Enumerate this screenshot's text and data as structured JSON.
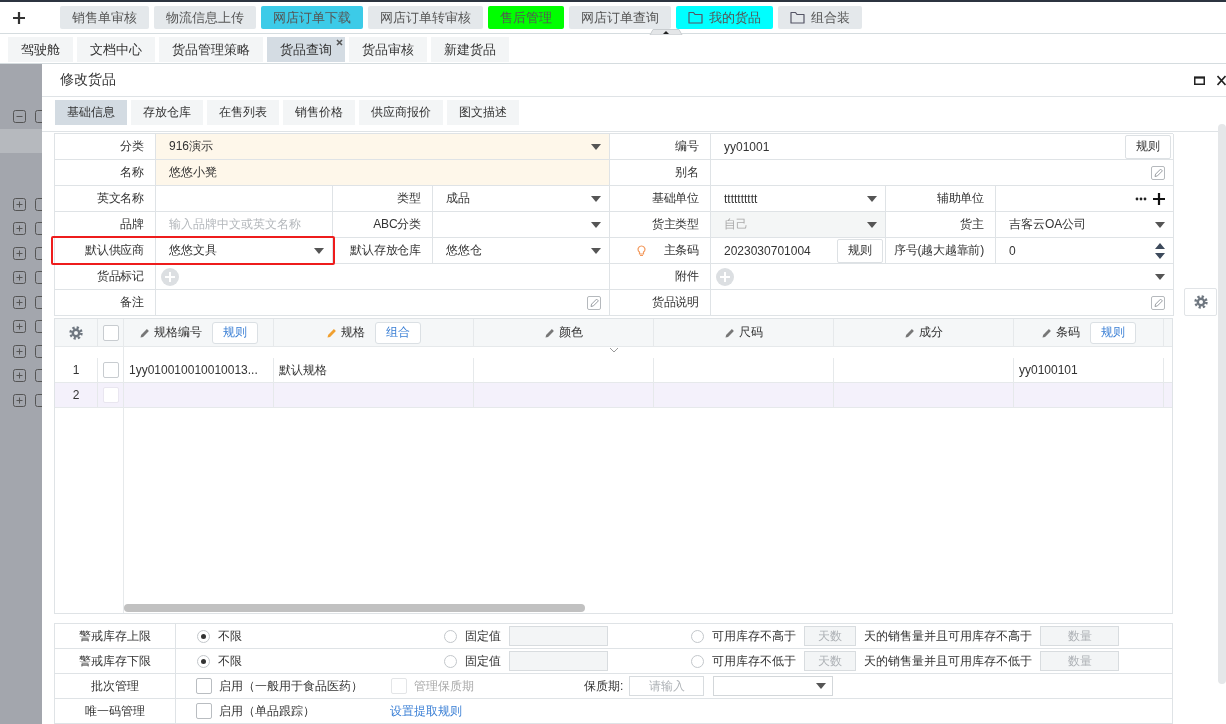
{
  "toolbar": {
    "buttons": [
      {
        "label": "销售单审核",
        "kind": "plain",
        "color": "#e4e8eb"
      },
      {
        "label": "物流信息上传",
        "kind": "plain",
        "color": "#e4e8eb"
      },
      {
        "label": "网店订单下载",
        "kind": "plain",
        "color": "#3ccbe8"
      },
      {
        "label": "网店订单转审核",
        "kind": "plain",
        "color": "#e4e8eb"
      },
      {
        "label": "售后管理",
        "kind": "plain",
        "color": "#00ff00"
      },
      {
        "label": "网店订单查询",
        "kind": "plain",
        "color": "#e4e8eb"
      },
      {
        "label": "我的货品",
        "kind": "folder",
        "color": "#00ffff"
      },
      {
        "label": "组合装",
        "kind": "folder",
        "color": "#e4e8eb"
      }
    ]
  },
  "page_tabs": [
    {
      "label": "驾驶舱",
      "selected": false
    },
    {
      "label": "文档中心",
      "selected": false
    },
    {
      "label": "货品管理策略",
      "selected": false
    },
    {
      "label": "货品查询",
      "selected": true,
      "closable": true
    },
    {
      "label": "货品审核",
      "selected": false
    },
    {
      "label": "新建货品",
      "selected": false
    }
  ],
  "sidebar": {
    "tree_nodes": [
      {
        "expanded": true,
        "selected": false
      },
      {
        "expanded": false
      },
      {
        "expanded": false
      },
      {
        "expanded": false
      },
      {
        "expanded": false
      },
      {
        "expanded": false
      },
      {
        "expanded": false
      },
      {
        "expanded": false
      },
      {
        "expanded": false
      },
      {
        "expanded": false
      }
    ]
  },
  "dialog": {
    "title": "修改货品",
    "tabs": [
      {
        "label": "基础信息",
        "selected": true
      },
      {
        "label": "存放仓库",
        "selected": false
      },
      {
        "label": "在售列表",
        "selected": false
      },
      {
        "label": "销售价格",
        "selected": false
      },
      {
        "label": "供应商报价",
        "selected": false
      },
      {
        "label": "图文描述",
        "selected": false
      }
    ],
    "form": {
      "rows": [
        [
          {
            "label": "分类",
            "kind": "select",
            "value": "916演示",
            "required": true
          },
          {
            "label": "编号",
            "kind": "text",
            "value": "yy01001",
            "button": "规则"
          }
        ],
        [
          {
            "label": "名称",
            "kind": "text",
            "value": "悠悠小凳",
            "required": true
          },
          {
            "label": "别名",
            "kind": "edit"
          }
        ],
        [
          {
            "label": "英文名称",
            "kind": "text"
          },
          {
            "label": "类型",
            "kind": "select",
            "value": "成品"
          },
          {
            "label": "基础单位",
            "kind": "select",
            "value": "tttttttttt"
          },
          {
            "label": "辅助单位",
            "kind": "units"
          }
        ],
        [
          {
            "label": "品牌",
            "kind": "text",
            "placeholder": "输入品牌中文或英文名称"
          },
          {
            "label": "ABC分类",
            "kind": "select"
          },
          {
            "label": "货主类型",
            "kind": "select",
            "value": "自己",
            "disabled": true
          },
          {
            "label": "货主",
            "kind": "select",
            "value": "吉客云OA公司"
          }
        ],
        [
          {
            "label": "默认供应商",
            "kind": "select",
            "value": "悠悠文具",
            "highlighted": true
          },
          {
            "label": "默认存放仓库",
            "kind": "select",
            "value": "悠悠仓"
          },
          {
            "label": "主条码",
            "kind": "text",
            "value": "2023030701004",
            "button": "规则",
            "hint": true
          },
          {
            "label": "序号(越大越靠前)",
            "kind": "spinner",
            "value": "0"
          }
        ],
        [
          {
            "label": "货品标记",
            "kind": "plus"
          },
          {
            "label": "附件",
            "kind": "plus_select"
          }
        ],
        [
          {
            "label": "备注",
            "kind": "edit"
          },
          {
            "label": "货品说明",
            "kind": "edit"
          }
        ]
      ]
    },
    "spec_grid": {
      "select_all": {
        "checked": false
      },
      "columns": [
        {
          "label": "规格编号",
          "button": "规则"
        },
        {
          "label": "规格",
          "button": "组合",
          "required": true
        },
        {
          "label": "颜色"
        },
        {
          "label": "尺码"
        },
        {
          "label": "成分"
        },
        {
          "label": "条码",
          "button": "规则"
        }
      ],
      "rows": [
        {
          "number": "1",
          "checked": false,
          "selected": false,
          "cells": [
            "1yy010010010010013...",
            "默认规格",
            null,
            null,
            null,
            "yy0100101"
          ]
        },
        {
          "number": "2",
          "checked": false,
          "selected": true
        }
      ]
    },
    "stock_settings": [
      {
        "kind": "limit",
        "label": "警戒库存上限",
        "options": [
          {
            "kind": "none",
            "label": "不限",
            "selected": true
          },
          {
            "kind": "fixed",
            "label": "固定值",
            "selected": false
          },
          {
            "kind": "sales",
            "label": "可用库存不高于",
            "selected": false,
            "days_placeholder": "天数",
            "note": "天的销售量并且可用库存不高于",
            "qty_placeholder": "数量"
          }
        ]
      },
      {
        "kind": "limit",
        "label": "警戒库存下限",
        "options": [
          {
            "kind": "none",
            "label": "不限",
            "selected": true
          },
          {
            "kind": "fixed",
            "label": "固定值",
            "selected": false
          },
          {
            "kind": "sales",
            "label": "可用库存不低于",
            "selected": false,
            "days_placeholder": "天数",
            "note": "天的销售量并且可用库存不低于",
            "qty_placeholder": "数量"
          }
        ]
      },
      {
        "kind": "batch",
        "label": "批次管理",
        "enable": {
          "label": "启用（一般用于食品医药）",
          "checked": false
        },
        "shelf_life_manage": {
          "label": "管理保质期",
          "checked": false,
          "disabled": true
        },
        "shelf_life": {
          "label": "保质期:",
          "placeholder": "请输入"
        }
      },
      {
        "kind": "unique",
        "label": "唯一码管理",
        "enable": {
          "label": "启用（单品跟踪）",
          "checked": false
        },
        "link": "设置提取规则"
      }
    ]
  }
}
